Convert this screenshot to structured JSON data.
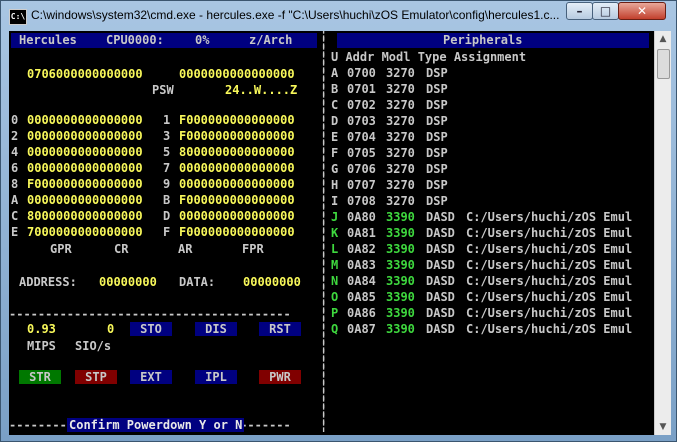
{
  "window": {
    "title": "C:\\windows\\system32\\cmd.exe - hercules.exe  -f \"C:\\Users\\huchi\\zOS Emulator\\config\\hercules1.c...",
    "icon_label": "C:\\",
    "buttons": {
      "minimize": "–",
      "maximize": "□",
      "close": "✕"
    }
  },
  "left": {
    "header": {
      "name": "Hercules",
      "cpu_label": "CPU0000:",
      "cpu_pct": "0%",
      "arch": "z/Arch"
    },
    "psw_line": {
      "a": "0706000000000000",
      "b": "0000000000000000"
    },
    "psw_label": "PSW",
    "psw_flags": "24..W....Z",
    "registers": [
      {
        "n1": "0",
        "v1": "0000000000000000",
        "n2": "1",
        "v2": "F000000000000000"
      },
      {
        "n1": "2",
        "v1": "0000000000000000",
        "n2": "3",
        "v2": "F000000000000000"
      },
      {
        "n1": "4",
        "v1": "0000000000000000",
        "n2": "5",
        "v2": "8000000000000000"
      },
      {
        "n1": "6",
        "v1": "0000000000000000",
        "n2": "7",
        "v2": "0000000000000000"
      },
      {
        "n1": "8",
        "v1": "F000000000000000",
        "n2": "9",
        "v2": "0000000000000000"
      },
      {
        "n1": "A",
        "v1": "0000000000000000",
        "n2": "B",
        "v2": "F000000000000000"
      },
      {
        "n1": "C",
        "v1": "8000000000000000",
        "n2": "D",
        "v2": "0000000000000000"
      },
      {
        "n1": "E",
        "v1": "7000000000000000",
        "n2": "F",
        "v2": "F000000000000000"
      }
    ],
    "reg_tabs": [
      "GPR",
      "CR",
      "AR",
      "FPR"
    ],
    "address_label": "ADDRESS:",
    "address_value": "00000000",
    "data_label": "DATA:",
    "data_value": "00000000",
    "mips_value": "0.93",
    "sios_value": "0",
    "mips_label": "MIPS",
    "sios_label": "SIO/s",
    "buttons_row1": [
      "STO",
      "DIS",
      "RST"
    ],
    "buttons_row2": [
      "STR",
      "STP",
      "EXT",
      "IPL",
      "PWR"
    ],
    "confirm_text": "Confirm Powerdown Y or N"
  },
  "right": {
    "header": "Peripherals",
    "columns_line": "U Addr Modl Type Assignment",
    "devices": [
      {
        "u": "A",
        "addr": "0700",
        "modl": "3270",
        "type": "DSP",
        "assignment": "",
        "color": "white"
      },
      {
        "u": "B",
        "addr": "0701",
        "modl": "3270",
        "type": "DSP",
        "assignment": "",
        "color": "white"
      },
      {
        "u": "C",
        "addr": "0702",
        "modl": "3270",
        "type": "DSP",
        "assignment": "",
        "color": "white"
      },
      {
        "u": "D",
        "addr": "0703",
        "modl": "3270",
        "type": "DSP",
        "assignment": "",
        "color": "white"
      },
      {
        "u": "E",
        "addr": "0704",
        "modl": "3270",
        "type": "DSP",
        "assignment": "",
        "color": "white"
      },
      {
        "u": "F",
        "addr": "0705",
        "modl": "3270",
        "type": "DSP",
        "assignment": "",
        "color": "white"
      },
      {
        "u": "G",
        "addr": "0706",
        "modl": "3270",
        "type": "DSP",
        "assignment": "",
        "color": "white"
      },
      {
        "u": "H",
        "addr": "0707",
        "modl": "3270",
        "type": "DSP",
        "assignment": "",
        "color": "white"
      },
      {
        "u": "I",
        "addr": "0708",
        "modl": "3270",
        "type": "DSP",
        "assignment": "",
        "color": "white"
      },
      {
        "u": "J",
        "addr": "0A80",
        "modl": "3390",
        "type": "DASD",
        "assignment": "C:/Users/huchi/zOS Emul",
        "color": "green"
      },
      {
        "u": "K",
        "addr": "0A81",
        "modl": "3390",
        "type": "DASD",
        "assignment": "C:/Users/huchi/zOS Emul",
        "color": "green"
      },
      {
        "u": "L",
        "addr": "0A82",
        "modl": "3390",
        "type": "DASD",
        "assignment": "C:/Users/huchi/zOS Emul",
        "color": "green"
      },
      {
        "u": "M",
        "addr": "0A83",
        "modl": "3390",
        "type": "DASD",
        "assignment": "C:/Users/huchi/zOS Emul",
        "color": "green"
      },
      {
        "u": "N",
        "addr": "0A84",
        "modl": "3390",
        "type": "DASD",
        "assignment": "C:/Users/huchi/zOS Emul",
        "color": "green"
      },
      {
        "u": "O",
        "addr": "0A85",
        "modl": "3390",
        "type": "DASD",
        "assignment": "C:/Users/huchi/zOS Emul",
        "color": "green"
      },
      {
        "u": "P",
        "addr": "0A86",
        "modl": "3390",
        "type": "DASD",
        "assignment": "C:/Users/huchi/zOS Emul",
        "color": "green"
      },
      {
        "u": "Q",
        "addr": "0A87",
        "modl": "3390",
        "type": "DASD",
        "assignment": "C:/Users/huchi/zOS Emul",
        "color": "green"
      }
    ]
  },
  "colors": {
    "text": "#c8c8c8",
    "highlight": "#f8f85a",
    "online": "#3ed83e",
    "header_bg": "#000080",
    "btn_green": "#007800",
    "btn_red": "#800000",
    "btn_blue": "#000080"
  }
}
